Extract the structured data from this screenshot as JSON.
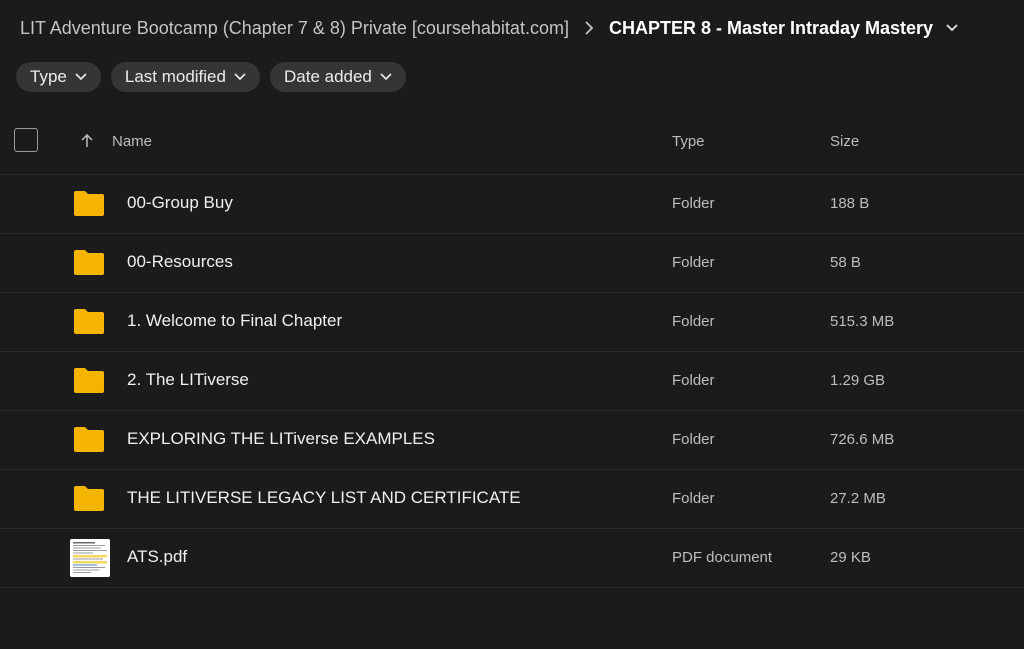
{
  "breadcrumb": {
    "parent": "LIT Adventure Bootcamp (Chapter 7 & 8) Private [coursehabitat.com]",
    "current": "CHAPTER 8 - Master Intraday Mastery"
  },
  "filters": [
    {
      "label": "Type"
    },
    {
      "label": "Last modified"
    },
    {
      "label": "Date added"
    }
  ],
  "table": {
    "headers": {
      "name": "Name",
      "type": "Type",
      "size": "Size"
    },
    "rows": [
      {
        "name": "00-Group Buy",
        "type": "Folder",
        "size": "188 B",
        "icon": "folder-icon"
      },
      {
        "name": "00-Resources",
        "type": "Folder",
        "size": "58 B",
        "icon": "folder-icon"
      },
      {
        "name": "1. Welcome to Final Chapter",
        "type": "Folder",
        "size": "515.3 MB",
        "icon": "folder-icon"
      },
      {
        "name": "2. The LITiverse",
        "type": "Folder",
        "size": "1.29 GB",
        "icon": "folder-icon"
      },
      {
        "name": "EXPLORING THE LITiverse EXAMPLES",
        "type": "Folder",
        "size": "726.6 MB",
        "icon": "folder-icon"
      },
      {
        "name": "THE LITIVERSE LEGACY LIST AND CERTIFICATE",
        "type": "Folder",
        "size": "27.2 MB",
        "icon": "folder-icon"
      },
      {
        "name": "ATS.pdf",
        "type": "PDF document",
        "size": "29 KB",
        "icon": "pdf-thumbnail"
      }
    ]
  },
  "colors": {
    "background": "#1b1b1b",
    "folder": "#f4b400",
    "chip": "#353535",
    "divider": "#2c2c2c"
  }
}
